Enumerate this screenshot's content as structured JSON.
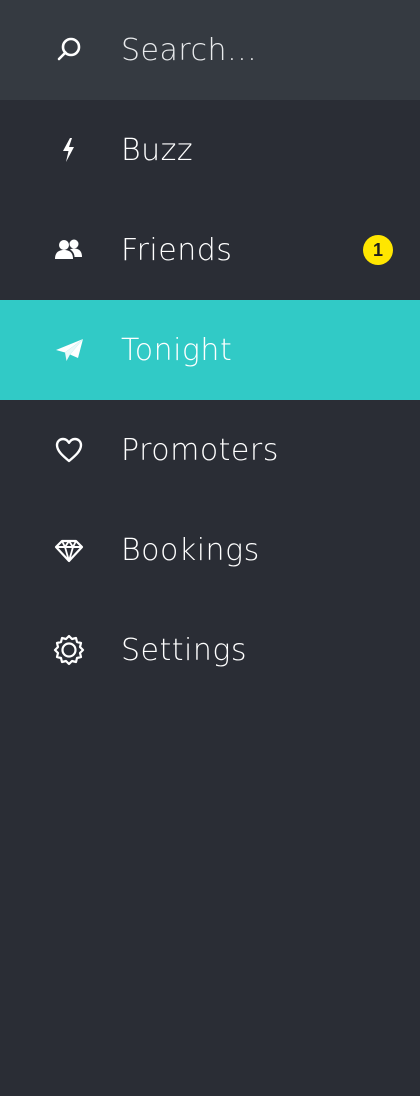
{
  "search": {
    "placeholder": "Search...",
    "icon": "search-icon"
  },
  "menu": {
    "items": [
      {
        "label": "Buzz",
        "icon": "lightning-icon"
      },
      {
        "label": "Friends",
        "icon": "people-icon",
        "badge": "1"
      },
      {
        "label": "Tonight",
        "icon": "paper-plane-icon",
        "active": true
      },
      {
        "label": "Promoters",
        "icon": "heart-icon"
      },
      {
        "label": "Bookings",
        "icon": "diamond-icon"
      },
      {
        "label": "Settings",
        "icon": "gear-icon"
      }
    ]
  },
  "colors": {
    "background": "#2a2d35",
    "search_background": "#353a41",
    "active_background": "#31cac6",
    "badge_background": "#ffe600",
    "text": "#ffffff"
  }
}
